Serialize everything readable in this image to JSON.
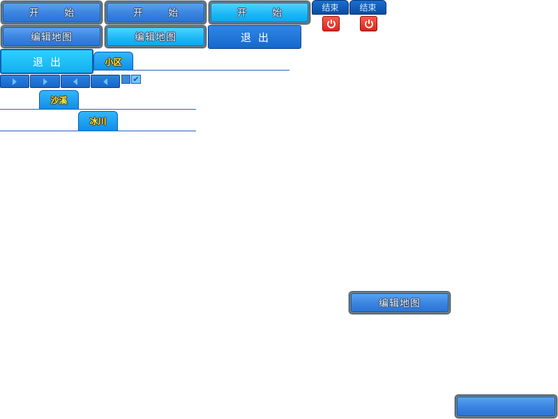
{
  "buttons": {
    "start_label": "开 始",
    "edit_map_label": "编辑地图",
    "quit_label": "退出",
    "end_label": "结束",
    "blank_label": ""
  },
  "tabs": {
    "xiaoqu": "小区",
    "shaxi": "沙溪",
    "bingchuan": "冰川"
  },
  "icons": {
    "power": "power-icon",
    "arrow_right": "arrow-right-icon",
    "arrow_left": "arrow-left-icon",
    "check": "check-icon"
  },
  "colors": {
    "blue_face": "#3a83e0",
    "cyan_face": "#1bb7f5",
    "dark_blue": "#1668cc",
    "power_red": "#d8261a",
    "tab_text": "#ffe84a",
    "end_text": "#cfe7ff"
  }
}
